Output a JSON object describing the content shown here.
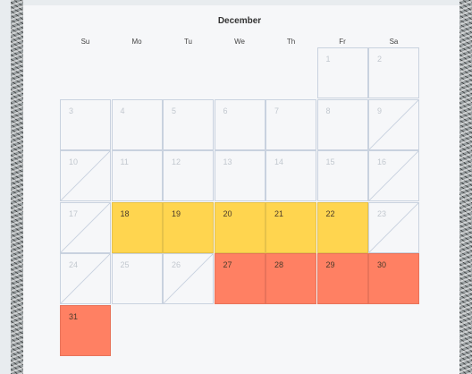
{
  "calendar": {
    "month": "December",
    "weekdays": [
      "Su",
      "Mo",
      "Tu",
      "We",
      "Th",
      "Fr",
      "Sa"
    ],
    "cells": [
      {
        "day": "1",
        "col": 5,
        "row": 0,
        "state": "past",
        "slash": false
      },
      {
        "day": "2",
        "col": 6,
        "row": 0,
        "state": "past",
        "slash": false
      },
      {
        "day": "3",
        "col": 0,
        "row": 1,
        "state": "past",
        "slash": false
      },
      {
        "day": "4",
        "col": 1,
        "row": 1,
        "state": "past",
        "slash": false
      },
      {
        "day": "5",
        "col": 2,
        "row": 1,
        "state": "past",
        "slash": false
      },
      {
        "day": "6",
        "col": 3,
        "row": 1,
        "state": "past",
        "slash": false
      },
      {
        "day": "7",
        "col": 4,
        "row": 1,
        "state": "past",
        "slash": false
      },
      {
        "day": "8",
        "col": 5,
        "row": 1,
        "state": "past",
        "slash": false
      },
      {
        "day": "9",
        "col": 6,
        "row": 1,
        "state": "past",
        "slash": true
      },
      {
        "day": "10",
        "col": 0,
        "row": 2,
        "state": "past",
        "slash": true
      },
      {
        "day": "11",
        "col": 1,
        "row": 2,
        "state": "past",
        "slash": false
      },
      {
        "day": "12",
        "col": 2,
        "row": 2,
        "state": "past",
        "slash": false
      },
      {
        "day": "13",
        "col": 3,
        "row": 2,
        "state": "past",
        "slash": false
      },
      {
        "day": "14",
        "col": 4,
        "row": 2,
        "state": "past",
        "slash": false
      },
      {
        "day": "15",
        "col": 5,
        "row": 2,
        "state": "past",
        "slash": false
      },
      {
        "day": "16",
        "col": 6,
        "row": 2,
        "state": "past",
        "slash": true
      },
      {
        "day": "17",
        "col": 0,
        "row": 3,
        "state": "past",
        "slash": true
      },
      {
        "day": "18",
        "col": 1,
        "row": 3,
        "state": "yellow",
        "slash": false
      },
      {
        "day": "19",
        "col": 2,
        "row": 3,
        "state": "yellow",
        "slash": false
      },
      {
        "day": "20",
        "col": 3,
        "row": 3,
        "state": "yellow",
        "slash": false
      },
      {
        "day": "21",
        "col": 4,
        "row": 3,
        "state": "yellow",
        "slash": false
      },
      {
        "day": "22",
        "col": 5,
        "row": 3,
        "state": "yellow",
        "slash": false
      },
      {
        "day": "23",
        "col": 6,
        "row": 3,
        "state": "past",
        "slash": true
      },
      {
        "day": "24",
        "col": 0,
        "row": 4,
        "state": "past",
        "slash": true
      },
      {
        "day": "25",
        "col": 1,
        "row": 4,
        "state": "past",
        "slash": false
      },
      {
        "day": "26",
        "col": 2,
        "row": 4,
        "state": "past",
        "slash": true
      },
      {
        "day": "27",
        "col": 3,
        "row": 4,
        "state": "coral",
        "slash": false
      },
      {
        "day": "28",
        "col": 4,
        "row": 4,
        "state": "coral",
        "slash": false
      },
      {
        "day": "29",
        "col": 5,
        "row": 4,
        "state": "coral",
        "slash": false
      },
      {
        "day": "30",
        "col": 6,
        "row": 4,
        "state": "coral",
        "slash": false
      },
      {
        "day": "31",
        "col": 0,
        "row": 5,
        "state": "coral",
        "slash": false
      }
    ]
  },
  "colors": {
    "highlight_yellow": "#ffd54f",
    "highlight_coral": "#ff8063",
    "grid": "#c9d2df"
  }
}
